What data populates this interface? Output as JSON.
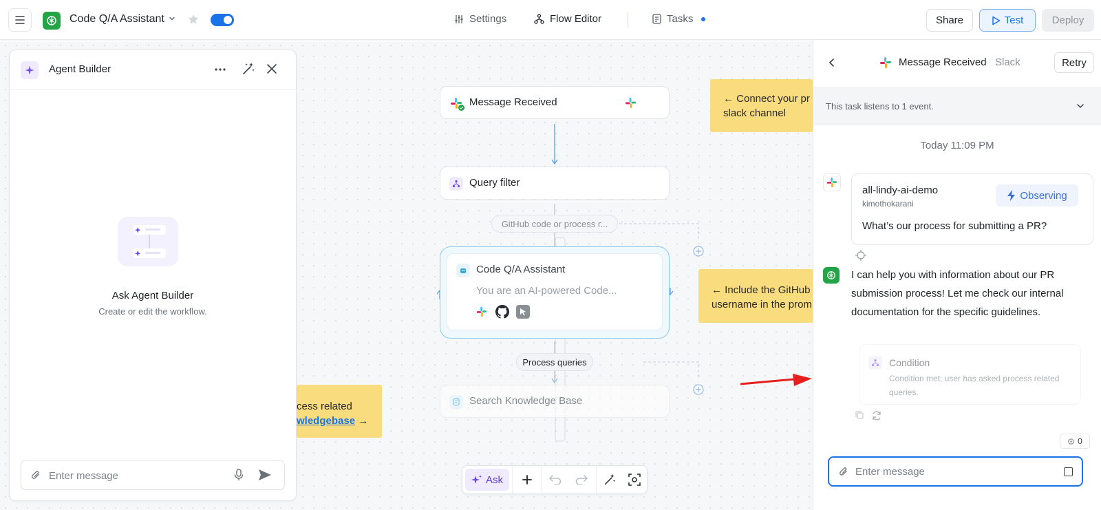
{
  "header": {
    "app_title": "Code Q/A Assistant",
    "nav": {
      "settings": "Settings",
      "flow_editor": "Flow Editor",
      "tasks": "Tasks"
    },
    "share_label": "Share",
    "test_label": "Test",
    "deploy_label": "Deploy"
  },
  "agent_builder": {
    "title": "Agent Builder",
    "empty_title": "Ask Agent Builder",
    "empty_subtitle": "Create or edit the workflow.",
    "input_placeholder": "Enter message"
  },
  "flow": {
    "node_message": "Message Received",
    "node_query": "Query filter",
    "pill_github": "GitHub code or process r...",
    "node_assistant_title": "Code Q/A Assistant",
    "node_assistant_desc": "You are an AI-powered Code...",
    "pill_process": "Process queries",
    "node_search": "Search Knowledge Base",
    "sticky_connect_line1": "← Connect your pr",
    "sticky_connect_line2": "slack channel",
    "sticky_include_line1": "← Include the GitHub",
    "sticky_include_line2": "username in the prom",
    "sticky_kb_line1": "cess related",
    "sticky_kb_link": "wledgebase",
    "sticky_kb_arrow": " →"
  },
  "toolbar": {
    "ask_label": "Ask"
  },
  "task_panel": {
    "title": "Message Received",
    "subtitle": "Slack",
    "retry_label": "Retry",
    "listen_text": "This task listens to 1 event.",
    "timestamp": "Today 11:09 PM",
    "message": {
      "channel": "all-lindy-ai-demo",
      "user": "kimothokarani",
      "status": "Observing",
      "text": "What’s our process for submitting a PR?"
    },
    "bot_reply": "I can help you with information about our PR submission process! Let me check our internal documentation for the specific guidelines.",
    "condition": {
      "title": "Condition",
      "description": "Condition met: user has asked process related queries."
    },
    "credits": "0",
    "input_placeholder": "Enter message"
  },
  "colors": {
    "accent": "#1a73e8",
    "sticky": "#f8dc7e",
    "brand_green": "#22a447",
    "annotation_arrow": "#e5201e"
  }
}
